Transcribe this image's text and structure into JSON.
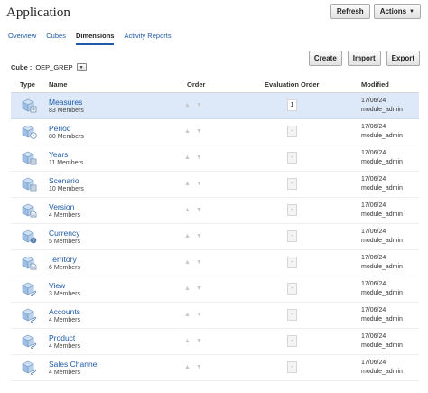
{
  "header": {
    "title": "Application",
    "refresh_label": "Refresh",
    "actions_label": "Actions"
  },
  "tabs": [
    {
      "label": "Overview"
    },
    {
      "label": "Cubes"
    },
    {
      "label": "Dimensions",
      "active": true
    },
    {
      "label": "Activity Reports"
    }
  ],
  "cube": {
    "label": "Cube :",
    "value": "OEP_GREP"
  },
  "toolbar": {
    "create_label": "Create",
    "import_label": "Import",
    "export_label": "Export"
  },
  "table": {
    "headers": {
      "type": "Type",
      "name": "Name",
      "order": "Order",
      "eval_order": "Evaluation Order",
      "modified": "Modified"
    },
    "rows": [
      {
        "name": "Measures",
        "members": "83 Members",
        "eval_order": "1",
        "date": "17/06/24",
        "user": "module_admin",
        "badge": "measures"
      },
      {
        "name": "Period",
        "members": "80 Members",
        "eval_order": "-",
        "date": "17/06/24",
        "user": "module_admin",
        "badge": "clock"
      },
      {
        "name": "Years",
        "members": "11 Members",
        "eval_order": "-",
        "date": "17/06/24",
        "user": "module_admin",
        "badge": "grid"
      },
      {
        "name": "Scenario",
        "members": "10 Members",
        "eval_order": "-",
        "date": "17/06/24",
        "user": "module_admin",
        "badge": "sheet"
      },
      {
        "name": "Version",
        "members": "4 Members",
        "eval_order": "-",
        "date": "17/06/24",
        "user": "module_admin",
        "badge": "doc"
      },
      {
        "name": "Currency",
        "members": "5 Members",
        "eval_order": "-",
        "date": "17/06/24",
        "user": "module_admin",
        "badge": "coin"
      },
      {
        "name": "Territory",
        "members": "6 Members",
        "eval_order": "-",
        "date": "17/06/24",
        "user": "module_admin",
        "badge": "doc"
      },
      {
        "name": "View",
        "members": "3 Members",
        "eval_order": "-",
        "date": "17/06/24",
        "user": "module_admin",
        "badge": "pencil"
      },
      {
        "name": "Accounts",
        "members": "4 Members",
        "eval_order": "-",
        "date": "17/06/24",
        "user": "module_admin",
        "badge": "pencil"
      },
      {
        "name": "Product",
        "members": "4 Members",
        "eval_order": "-",
        "date": "17/06/24",
        "user": "module_admin",
        "badge": "pencil"
      },
      {
        "name": "Sales Channel",
        "members": "4 Members",
        "eval_order": "-",
        "date": "17/06/24",
        "user": "module_admin",
        "badge": "pencil"
      }
    ]
  },
  "colors": {
    "link": "#1f5aa6",
    "selected_row": "#dde9f8",
    "cube_icon": "#7aa7d6"
  }
}
